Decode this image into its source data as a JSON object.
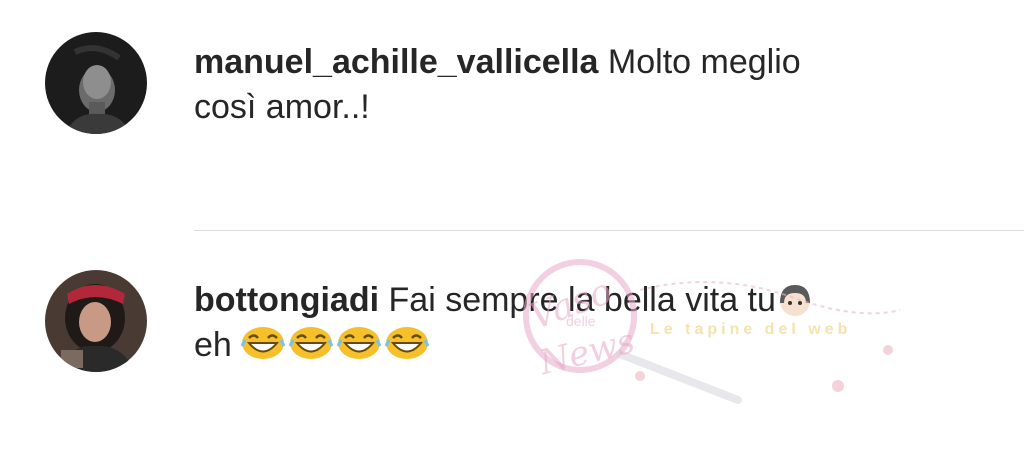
{
  "comments": [
    {
      "username": "manuel_achille_vallicella",
      "text_line1": "Molto meglio",
      "text_line2": "così amor..!",
      "avatar": "profile-photo-man"
    },
    {
      "username": "bottongiadi",
      "text_line1": "Fai sempre la bella vita tu",
      "text_line2": "eh",
      "avatar": "profile-photo-woman",
      "inline_icon": "girl-face-emoji",
      "trailing_emojis": [
        "laughing-emoji",
        "laughing-emoji",
        "laughing-emoji",
        "laughing-emoji"
      ]
    }
  ],
  "watermark": {
    "text_main": "Vaso",
    "text_delle": "delle",
    "text_news": "News",
    "text_tag": "Le tapine del web"
  },
  "colors": {
    "text": "#262626",
    "divider": "#dbdbdb",
    "emoji_yellow": "#f5c02b",
    "watermark_pink": "#e8a8c8"
  }
}
